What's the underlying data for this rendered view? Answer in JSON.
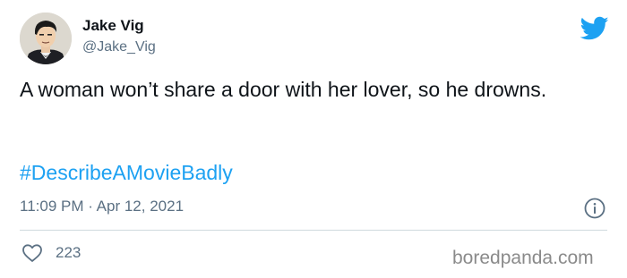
{
  "tweet": {
    "author_name": "Jake Vig",
    "author_handle": "@Jake_Vig",
    "text": "A woman won’t share a door with her lover, so he drowns.",
    "hashtag": "#DescribeAMovieBadly",
    "timestamp": "11:09 PM · Apr 12, 2021",
    "like_count": "223"
  },
  "watermark": "boredpanda.com",
  "icons": {
    "avatar": "avatar",
    "brand": "twitter-bird-icon",
    "info": "info-icon",
    "like": "heart-outline-icon"
  },
  "colors": {
    "brand": "#1da1f2",
    "text": "#0f1419",
    "secondary": "#5b7083",
    "divider": "#cfd9de"
  }
}
